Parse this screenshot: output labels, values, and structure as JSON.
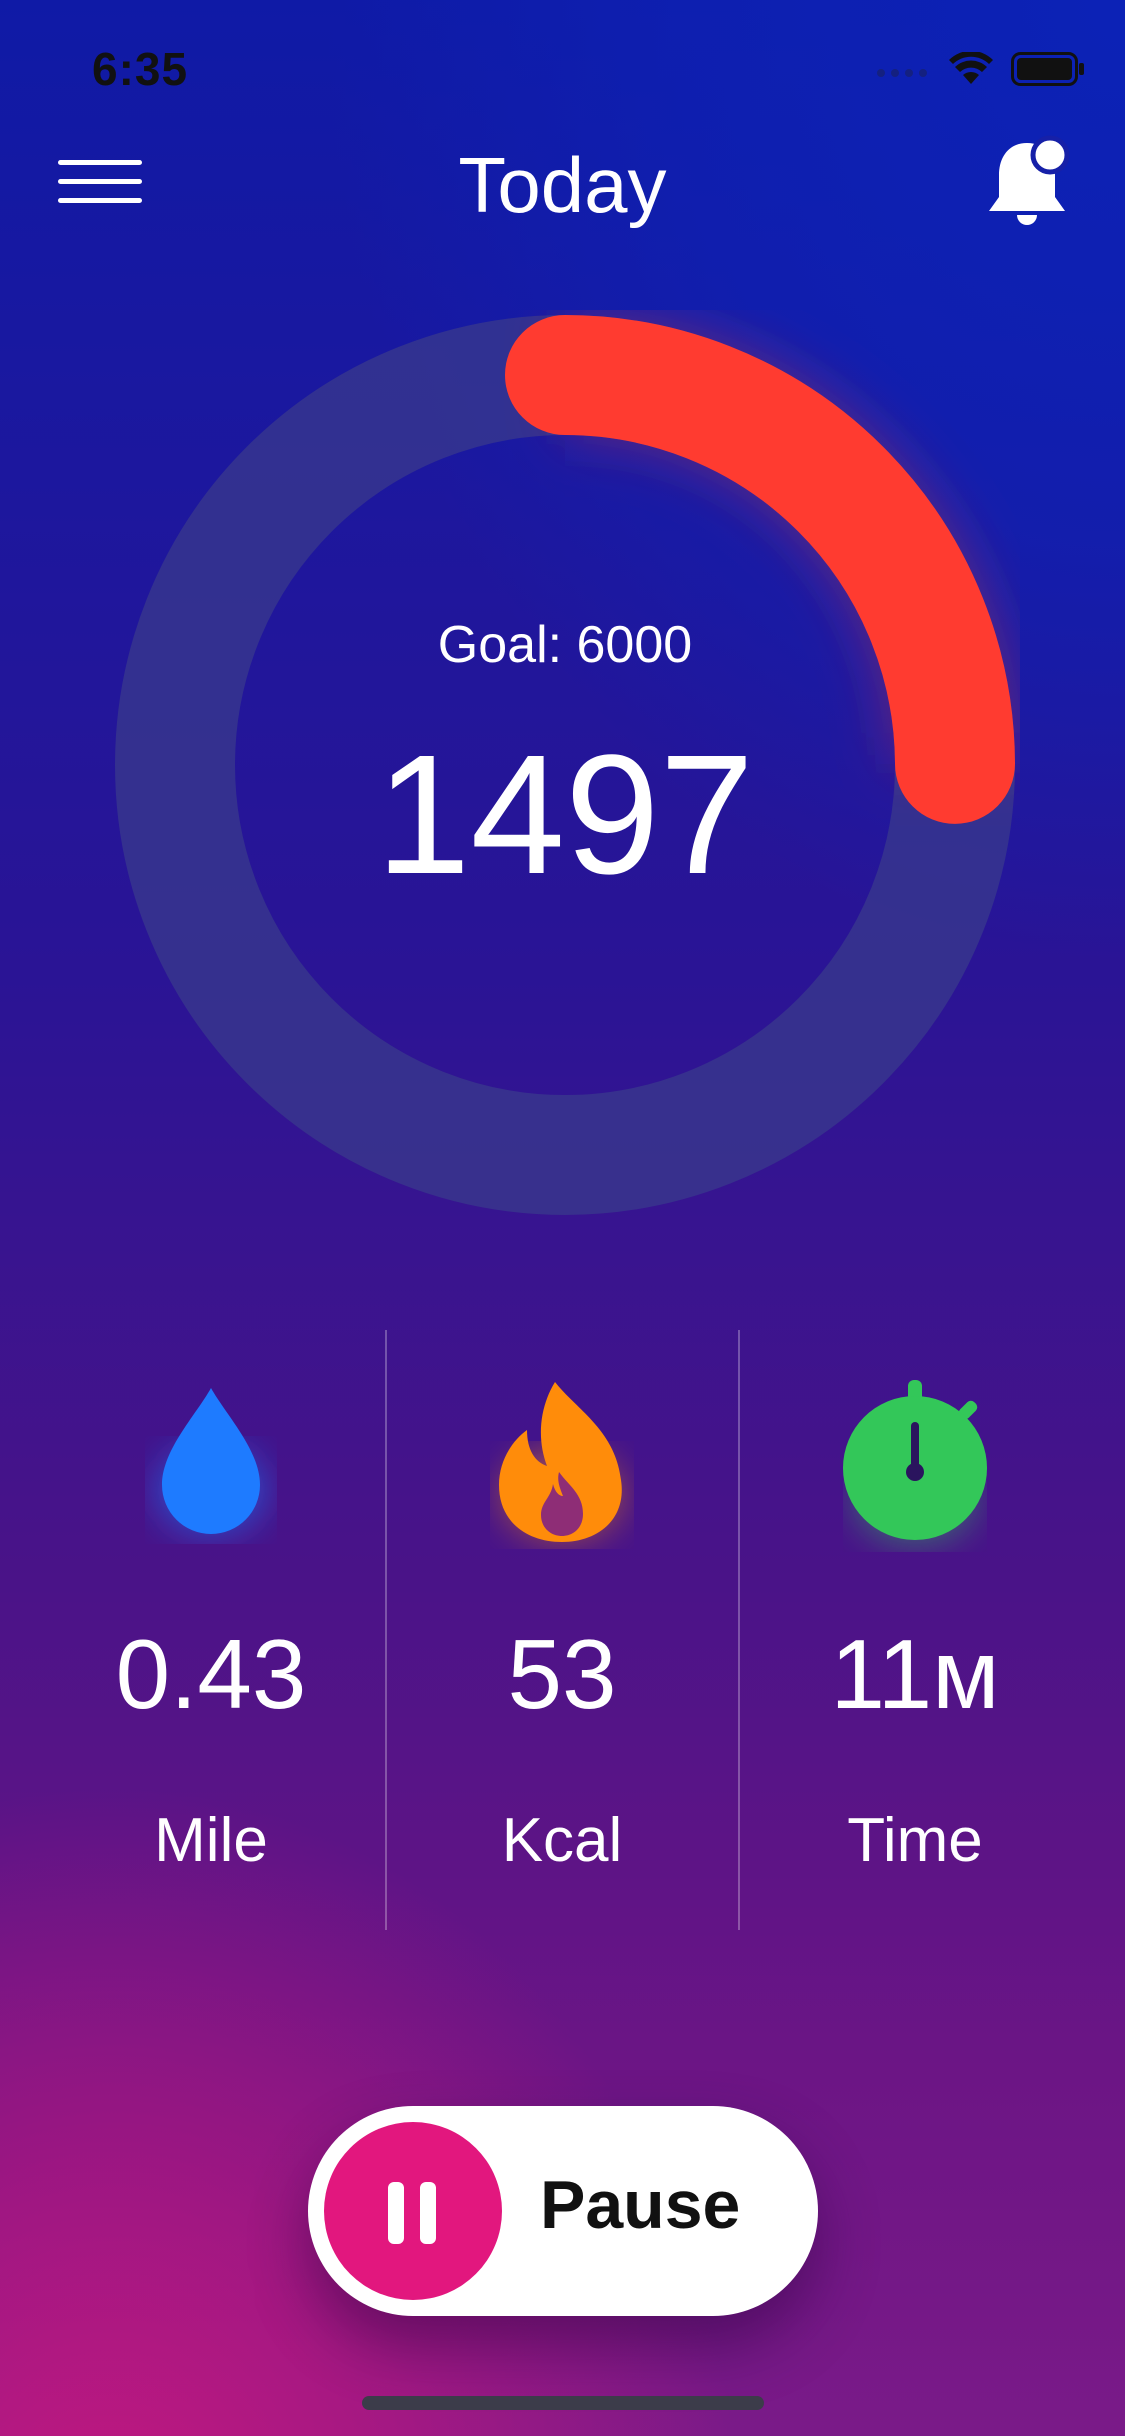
{
  "status_bar": {
    "time": "6:35",
    "icons": [
      "signal-icon",
      "wifi-icon",
      "battery-icon"
    ]
  },
  "header": {
    "title": "Today",
    "menu_icon": "hamburger-menu-icon",
    "bell_icon": "bell-icon"
  },
  "progress": {
    "goal_label": "Goal: 6000",
    "steps": "1497",
    "fraction": 0.2495,
    "ring_color": "#ff3b30",
    "track_color": "#3a3a8c"
  },
  "stats": [
    {
      "icon": "water-drop-icon",
      "value": "0.43",
      "label": "Mile",
      "color": "#1e7bff"
    },
    {
      "icon": "flame-icon",
      "value": "53",
      "label": "Kcal",
      "color": "#ff8c0a"
    },
    {
      "icon": "stopwatch-icon",
      "value": "11м",
      "label": "Time",
      "color": "#33c759"
    }
  ],
  "pause_button": {
    "label": "Pause",
    "icon": "pause-icon",
    "color": "#e2177e"
  }
}
